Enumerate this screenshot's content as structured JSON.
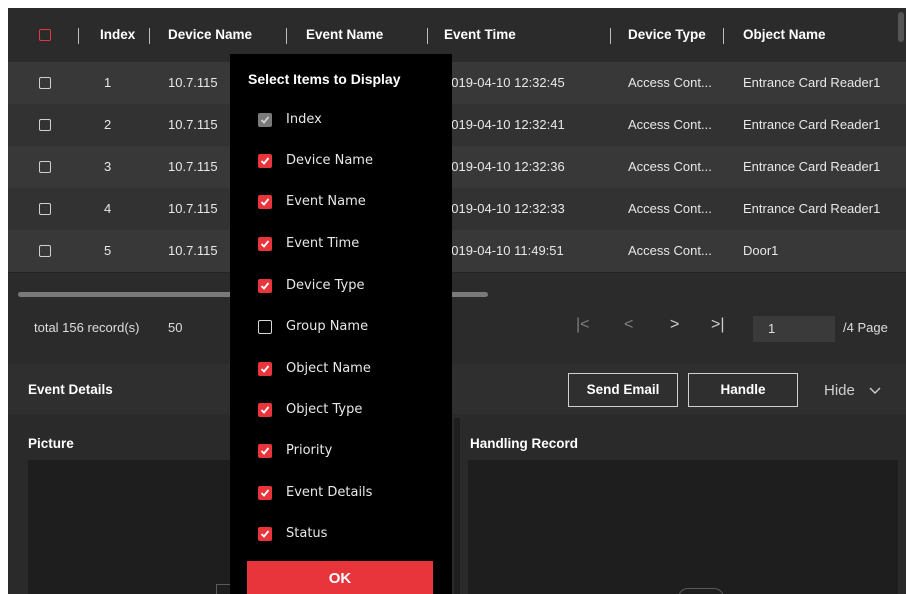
{
  "table": {
    "columns": [
      "Index",
      "Device Name",
      "Event Name",
      "Event Time",
      "Device Type",
      "Object Name"
    ],
    "rows": [
      {
        "index": "1",
        "device": "10.7.115",
        "time": "2019-04-10 12:32:45",
        "type": "Access Cont...",
        "object": "Entrance Card Reader1"
      },
      {
        "index": "2",
        "device": "10.7.115",
        "time": "2019-04-10 12:32:41",
        "type": "Access Cont...",
        "object": "Entrance Card Reader1"
      },
      {
        "index": "3",
        "device": "10.7.115",
        "time": "2019-04-10 12:32:36",
        "type": "Access Cont...",
        "object": "Entrance Card Reader1"
      },
      {
        "index": "4",
        "device": "10.7.115",
        "time": "2019-04-10 12:32:33",
        "type": "Access Cont...",
        "object": "Entrance Card Reader1"
      },
      {
        "index": "5",
        "device": "10.7.115",
        "time": "2019-04-10 11:49:51",
        "type": "Access Cont...",
        "object": "Door1"
      }
    ]
  },
  "pagination": {
    "total": "total 156 record(s)",
    "page_size": "50",
    "first_icon": "|<",
    "prev_icon": "<",
    "next_icon": ">",
    "last_icon": ">|",
    "current_page": "1",
    "total_pages": "/4 Page"
  },
  "event_details": {
    "title": "Event Details",
    "send_email": "Send Email",
    "handle": "Handle",
    "hide": "Hide",
    "picture_label": "Picture",
    "handling_record_label": "Handling Record"
  },
  "popup": {
    "title": "Select Items to Display",
    "items": [
      {
        "label": "Index",
        "state": "disabled"
      },
      {
        "label": "Device Name",
        "state": "checked"
      },
      {
        "label": "Event Name",
        "state": "checked"
      },
      {
        "label": "Event Time",
        "state": "checked"
      },
      {
        "label": "Device Type",
        "state": "checked"
      },
      {
        "label": "Group Name",
        "state": "unchecked"
      },
      {
        "label": "Object Name",
        "state": "checked"
      },
      {
        "label": "Object Type",
        "state": "checked"
      },
      {
        "label": "Priority",
        "state": "checked"
      },
      {
        "label": "Event Details",
        "state": "checked"
      },
      {
        "label": "Status",
        "state": "checked"
      }
    ],
    "ok_label": "OK"
  },
  "colors": {
    "accent": "#e8353c",
    "background": "#2b2b2b",
    "row_alt": "#383838",
    "popup_bg": "#000000"
  }
}
